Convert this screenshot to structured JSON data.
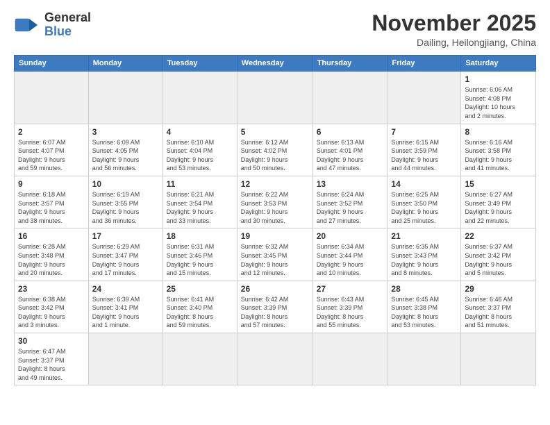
{
  "header": {
    "logo_general": "General",
    "logo_blue": "Blue",
    "month_title": "November 2025",
    "location": "Dailing, Heilongjiang, China"
  },
  "weekdays": [
    "Sunday",
    "Monday",
    "Tuesday",
    "Wednesday",
    "Thursday",
    "Friday",
    "Saturday"
  ],
  "weeks": [
    [
      {
        "day": "",
        "info": ""
      },
      {
        "day": "",
        "info": ""
      },
      {
        "day": "",
        "info": ""
      },
      {
        "day": "",
        "info": ""
      },
      {
        "day": "",
        "info": ""
      },
      {
        "day": "",
        "info": ""
      },
      {
        "day": "1",
        "info": "Sunrise: 6:06 AM\nSunset: 4:08 PM\nDaylight: 10 hours\nand 2 minutes."
      }
    ],
    [
      {
        "day": "2",
        "info": "Sunrise: 6:07 AM\nSunset: 4:07 PM\nDaylight: 9 hours\nand 59 minutes."
      },
      {
        "day": "3",
        "info": "Sunrise: 6:09 AM\nSunset: 4:05 PM\nDaylight: 9 hours\nand 56 minutes."
      },
      {
        "day": "4",
        "info": "Sunrise: 6:10 AM\nSunset: 4:04 PM\nDaylight: 9 hours\nand 53 minutes."
      },
      {
        "day": "5",
        "info": "Sunrise: 6:12 AM\nSunset: 4:02 PM\nDaylight: 9 hours\nand 50 minutes."
      },
      {
        "day": "6",
        "info": "Sunrise: 6:13 AM\nSunset: 4:01 PM\nDaylight: 9 hours\nand 47 minutes."
      },
      {
        "day": "7",
        "info": "Sunrise: 6:15 AM\nSunset: 3:59 PM\nDaylight: 9 hours\nand 44 minutes."
      },
      {
        "day": "8",
        "info": "Sunrise: 6:16 AM\nSunset: 3:58 PM\nDaylight: 9 hours\nand 41 minutes."
      }
    ],
    [
      {
        "day": "9",
        "info": "Sunrise: 6:18 AM\nSunset: 3:57 PM\nDaylight: 9 hours\nand 38 minutes."
      },
      {
        "day": "10",
        "info": "Sunrise: 6:19 AM\nSunset: 3:55 PM\nDaylight: 9 hours\nand 36 minutes."
      },
      {
        "day": "11",
        "info": "Sunrise: 6:21 AM\nSunset: 3:54 PM\nDaylight: 9 hours\nand 33 minutes."
      },
      {
        "day": "12",
        "info": "Sunrise: 6:22 AM\nSunset: 3:53 PM\nDaylight: 9 hours\nand 30 minutes."
      },
      {
        "day": "13",
        "info": "Sunrise: 6:24 AM\nSunset: 3:52 PM\nDaylight: 9 hours\nand 27 minutes."
      },
      {
        "day": "14",
        "info": "Sunrise: 6:25 AM\nSunset: 3:50 PM\nDaylight: 9 hours\nand 25 minutes."
      },
      {
        "day": "15",
        "info": "Sunrise: 6:27 AM\nSunset: 3:49 PM\nDaylight: 9 hours\nand 22 minutes."
      }
    ],
    [
      {
        "day": "16",
        "info": "Sunrise: 6:28 AM\nSunset: 3:48 PM\nDaylight: 9 hours\nand 20 minutes."
      },
      {
        "day": "17",
        "info": "Sunrise: 6:29 AM\nSunset: 3:47 PM\nDaylight: 9 hours\nand 17 minutes."
      },
      {
        "day": "18",
        "info": "Sunrise: 6:31 AM\nSunset: 3:46 PM\nDaylight: 9 hours\nand 15 minutes."
      },
      {
        "day": "19",
        "info": "Sunrise: 6:32 AM\nSunset: 3:45 PM\nDaylight: 9 hours\nand 12 minutes."
      },
      {
        "day": "20",
        "info": "Sunrise: 6:34 AM\nSunset: 3:44 PM\nDaylight: 9 hours\nand 10 minutes."
      },
      {
        "day": "21",
        "info": "Sunrise: 6:35 AM\nSunset: 3:43 PM\nDaylight: 9 hours\nand 8 minutes."
      },
      {
        "day": "22",
        "info": "Sunrise: 6:37 AM\nSunset: 3:42 PM\nDaylight: 9 hours\nand 5 minutes."
      }
    ],
    [
      {
        "day": "23",
        "info": "Sunrise: 6:38 AM\nSunset: 3:42 PM\nDaylight: 9 hours\nand 3 minutes."
      },
      {
        "day": "24",
        "info": "Sunrise: 6:39 AM\nSunset: 3:41 PM\nDaylight: 9 hours\nand 1 minute."
      },
      {
        "day": "25",
        "info": "Sunrise: 6:41 AM\nSunset: 3:40 PM\nDaylight: 8 hours\nand 59 minutes."
      },
      {
        "day": "26",
        "info": "Sunrise: 6:42 AM\nSunset: 3:39 PM\nDaylight: 8 hours\nand 57 minutes."
      },
      {
        "day": "27",
        "info": "Sunrise: 6:43 AM\nSunset: 3:39 PM\nDaylight: 8 hours\nand 55 minutes."
      },
      {
        "day": "28",
        "info": "Sunrise: 6:45 AM\nSunset: 3:38 PM\nDaylight: 8 hours\nand 53 minutes."
      },
      {
        "day": "29",
        "info": "Sunrise: 6:46 AM\nSunset: 3:37 PM\nDaylight: 8 hours\nand 51 minutes."
      }
    ],
    [
      {
        "day": "30",
        "info": "Sunrise: 6:47 AM\nSunset: 3:37 PM\nDaylight: 8 hours\nand 49 minutes."
      },
      {
        "day": "",
        "info": ""
      },
      {
        "day": "",
        "info": ""
      },
      {
        "day": "",
        "info": ""
      },
      {
        "day": "",
        "info": ""
      },
      {
        "day": "",
        "info": ""
      },
      {
        "day": "",
        "info": ""
      }
    ]
  ]
}
